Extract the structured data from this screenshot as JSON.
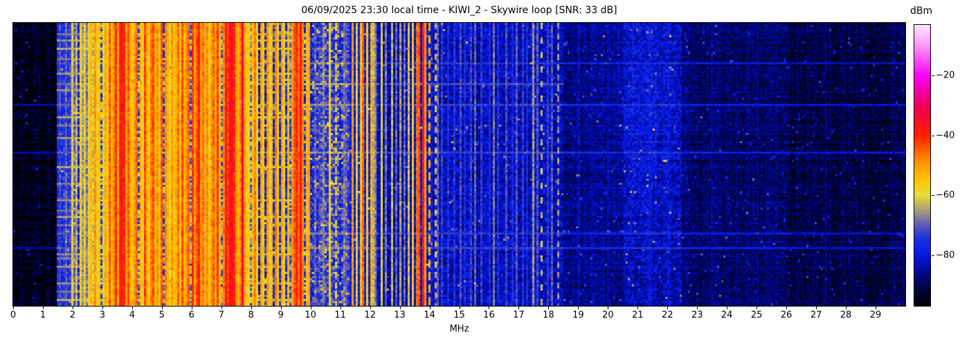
{
  "title": "06/09/2025 23:30 local time - KIWI_2 - Skywire loop [SNR: 33 dB]",
  "station": "KIWI_2",
  "antenna": "Skywire loop",
  "snr_db": 33,
  "timestamp_text": "06/09/2025 23:30 local time",
  "x_axis": {
    "label": "MHz",
    "range": [
      0,
      30
    ],
    "ticks": [
      0,
      1,
      2,
      3,
      4,
      5,
      6,
      7,
      8,
      9,
      10,
      11,
      12,
      13,
      14,
      15,
      16,
      17,
      18,
      19,
      20,
      21,
      22,
      23,
      24,
      25,
      26,
      27,
      28,
      29
    ]
  },
  "colorbar": {
    "label": "dBm",
    "min": -97,
    "max": -3,
    "ticks": [
      {
        "value": -20,
        "label": "−20"
      },
      {
        "value": -40,
        "label": "−40"
      },
      {
        "value": -60,
        "label": "−60"
      },
      {
        "value": -80,
        "label": "−80"
      }
    ],
    "stops": [
      [
        0.0,
        "#000000"
      ],
      [
        0.06,
        "#000340"
      ],
      [
        0.12,
        "#00088f"
      ],
      [
        0.181,
        "#0718e2"
      ],
      [
        0.24,
        "#1c30dc"
      ],
      [
        0.29,
        "#5f5cb4"
      ],
      [
        0.33,
        "#9c9088"
      ],
      [
        0.394,
        "#e8dc3a"
      ],
      [
        0.45,
        "#ffc400"
      ],
      [
        0.52,
        "#ff8a00"
      ],
      [
        0.606,
        "#ff2000"
      ],
      [
        0.7,
        "#ee0048"
      ],
      [
        0.819,
        "#fa00fa"
      ],
      [
        0.93,
        "#ff9af8"
      ],
      [
        1.0,
        "#ffe6ff"
      ]
    ]
  },
  "chart_data": {
    "type": "heatmap",
    "title": "06/09/2025 23:30 local time - KIWI_2 - Skywire loop [SNR: 33 dB]",
    "xlabel": "MHz",
    "x_range": [
      0,
      30
    ],
    "value_unit": "dBm",
    "value_range": [
      -97,
      -3
    ],
    "legend": "waterfall spectrogram, time on vertical axis, frequency 0-30 MHz on horizontal axis",
    "bands": [
      {
        "a": 0.0,
        "b": 1.45,
        "l": -94.5
      },
      {
        "a": 1.45,
        "b": 2.0,
        "l": -80
      },
      {
        "a": 2.0,
        "b": 2.6,
        "l": -78
      },
      {
        "a": 2.6,
        "b": 3.2,
        "l": -74
      },
      {
        "a": 3.2,
        "b": 8.0,
        "l": -71
      },
      {
        "a": 8.0,
        "b": 9.3,
        "l": -77
      },
      {
        "a": 9.3,
        "b": 10.0,
        "l": -73
      },
      {
        "a": 10.0,
        "b": 11.3,
        "l": -76
      },
      {
        "a": 11.3,
        "b": 12.3,
        "l": -80
      },
      {
        "a": 12.3,
        "b": 13.4,
        "l": -84
      },
      {
        "a": 13.4,
        "b": 14.1,
        "l": -80
      },
      {
        "a": 14.1,
        "b": 18.5,
        "l": -83
      },
      {
        "a": 18.5,
        "b": 20.5,
        "l": -86.5
      },
      {
        "a": 20.5,
        "b": 22.5,
        "l": -84
      },
      {
        "a": 22.5,
        "b": 26.0,
        "l": -88.5
      },
      {
        "a": 26.0,
        "b": 30.0,
        "l": -91
      }
    ],
    "clouds": [
      {
        "f": 21.3,
        "fw": 1.1,
        "y": 0.3,
        "yw": 0.4,
        "g": 5
      },
      {
        "f": 10.6,
        "fw": 0.9,
        "y": 0.5,
        "yw": 0.7,
        "g": 2
      }
    ],
    "signals": [
      {
        "f": 1.48,
        "l": -76
      },
      {
        "f": 1.55,
        "l": -72
      },
      {
        "f": 1.62,
        "l": -76
      },
      {
        "f": 1.7,
        "l": -74
      },
      {
        "f": 1.78,
        "l": -70
      },
      {
        "f": 1.85,
        "l": -75
      },
      {
        "f": 1.93,
        "l": -73
      },
      {
        "f": 2.02,
        "l": -60
      },
      {
        "f": 2.08,
        "l": -70
      },
      {
        "f": 2.15,
        "l": -64
      },
      {
        "f": 2.24,
        "l": -57
      },
      {
        "f": 2.32,
        "l": -66
      },
      {
        "f": 2.4,
        "l": -60
      },
      {
        "f": 2.47,
        "l": -68
      },
      {
        "f": 2.55,
        "l": -58
      },
      {
        "f": 2.62,
        "l": -54
      },
      {
        "f": 2.7,
        "l": -62
      },
      {
        "f": 2.78,
        "l": -50
      },
      {
        "f": 2.86,
        "l": -58
      },
      {
        "f": 2.93,
        "l": -55
      },
      {
        "f": 3.0,
        "l": -60
      },
      {
        "f": 3.08,
        "l": -52
      },
      {
        "f": 3.15,
        "l": -57
      },
      {
        "f": 3.21,
        "l": -44
      },
      {
        "f": 3.28,
        "l": -54
      },
      {
        "f": 3.35,
        "l": -48
      },
      {
        "f": 3.42,
        "l": -41
      },
      {
        "f": 3.5,
        "l": -52
      },
      {
        "f": 3.58,
        "l": -38,
        "w": 0.12
      },
      {
        "f": 3.65,
        "l": -46
      },
      {
        "f": 3.72,
        "l": -40
      },
      {
        "f": 3.8,
        "l": -50
      },
      {
        "f": 3.87,
        "l": -44
      },
      {
        "f": 3.94,
        "l": -53
      },
      {
        "f": 4.02,
        "l": -56
      },
      {
        "f": 4.1,
        "l": -50
      },
      {
        "f": 4.18,
        "l": -45
      },
      {
        "f": 4.26,
        "l": -54
      },
      {
        "f": 4.33,
        "l": -58
      },
      {
        "f": 4.4,
        "l": -42
      },
      {
        "f": 4.48,
        "l": -52
      },
      {
        "f": 4.56,
        "l": -56
      },
      {
        "f": 4.64,
        "l": -47
      },
      {
        "f": 4.72,
        "l": -43
      },
      {
        "f": 4.8,
        "l": -53
      },
      {
        "f": 4.88,
        "l": -49
      },
      {
        "f": 4.95,
        "l": -55
      },
      {
        "f": 5.02,
        "l": -44
      },
      {
        "f": 5.1,
        "l": -48
      },
      {
        "f": 5.18,
        "l": -54
      },
      {
        "f": 5.26,
        "l": -58
      },
      {
        "f": 5.33,
        "l": -50
      },
      {
        "f": 5.4,
        "l": -56
      },
      {
        "f": 5.48,
        "l": -52
      },
      {
        "f": 5.55,
        "l": -46
      },
      {
        "f": 5.62,
        "l": -55
      },
      {
        "f": 5.7,
        "l": -43
      },
      {
        "f": 5.78,
        "l": -53
      },
      {
        "f": 5.85,
        "l": -49
      },
      {
        "f": 5.93,
        "l": -45
      },
      {
        "f": 6.0,
        "l": -41
      },
      {
        "f": 6.07,
        "l": -50
      },
      {
        "f": 6.15,
        "l": -44
      },
      {
        "f": 6.22,
        "l": -39,
        "w": 0.1
      },
      {
        "f": 6.3,
        "l": -51
      },
      {
        "f": 6.37,
        "l": -46
      },
      {
        "f": 6.45,
        "l": -54
      },
      {
        "f": 6.52,
        "l": -48
      },
      {
        "f": 6.6,
        "l": -57
      },
      {
        "f": 6.68,
        "l": -50
      },
      {
        "f": 6.76,
        "l": -45
      },
      {
        "f": 6.83,
        "l": -52
      },
      {
        "f": 6.9,
        "l": -41
      },
      {
        "f": 6.97,
        "l": -54
      },
      {
        "f": 7.05,
        "l": -47
      },
      {
        "f": 7.12,
        "l": -38
      },
      {
        "f": 7.2,
        "l": -42
      },
      {
        "f": 7.28,
        "l": -36,
        "w": 0.12
      },
      {
        "f": 7.35,
        "l": -44
      },
      {
        "f": 7.42,
        "l": -40
      },
      {
        "f": 7.5,
        "l": -49
      },
      {
        "f": 7.58,
        "l": -53
      },
      {
        "f": 7.65,
        "l": -47
      },
      {
        "f": 7.72,
        "l": -31,
        "w": 0.1
      },
      {
        "f": 7.8,
        "l": -50
      },
      {
        "f": 7.88,
        "l": -56
      },
      {
        "f": 7.95,
        "l": -58
      },
      {
        "f": 8.03,
        "l": -54
      },
      {
        "f": 8.12,
        "l": -47
      },
      {
        "f": 8.22,
        "l": -58
      },
      {
        "f": 8.32,
        "l": -51
      },
      {
        "f": 8.42,
        "l": -56
      },
      {
        "f": 8.52,
        "l": -49
      },
      {
        "f": 8.62,
        "l": -60
      },
      {
        "f": 8.72,
        "l": -54
      },
      {
        "f": 8.82,
        "l": -47
      },
      {
        "f": 8.92,
        "l": -57
      },
      {
        "f": 9.02,
        "l": -51
      },
      {
        "f": 9.12,
        "l": -59
      },
      {
        "f": 9.22,
        "l": -54
      },
      {
        "f": 9.35,
        "l": -50
      },
      {
        "f": 9.45,
        "l": -44
      },
      {
        "f": 9.52,
        "l": -40,
        "w": 0.1
      },
      {
        "f": 9.6,
        "l": -46
      },
      {
        "f": 9.68,
        "l": -37,
        "w": 0.1
      },
      {
        "f": 9.76,
        "l": -49
      },
      {
        "f": 9.84,
        "l": -54
      },
      {
        "f": 9.92,
        "l": -51
      },
      {
        "f": 10.12,
        "l": -70
      },
      {
        "f": 10.3,
        "l": -72
      },
      {
        "f": 10.45,
        "l": -68
      },
      {
        "f": 10.65,
        "l": -58
      },
      {
        "f": 10.84,
        "l": -62,
        "d": 0.6,
        "p": 5
      },
      {
        "f": 11.1,
        "l": -68
      },
      {
        "f": 11.22,
        "l": -71
      },
      {
        "f": 11.42,
        "l": -50
      },
      {
        "f": 11.55,
        "l": -60
      },
      {
        "f": 11.7,
        "l": -55
      },
      {
        "f": 11.77,
        "l": -45
      },
      {
        "f": 11.9,
        "l": -58
      },
      {
        "f": 12.0,
        "l": -52
      },
      {
        "f": 12.1,
        "l": -63
      },
      {
        "f": 12.2,
        "l": -67
      },
      {
        "f": 12.4,
        "l": -60
      },
      {
        "f": 12.55,
        "l": -68
      },
      {
        "f": 12.7,
        "l": -63
      },
      {
        "f": 12.85,
        "l": -70
      },
      {
        "f": 13.0,
        "l": -65
      },
      {
        "f": 13.15,
        "l": -69
      },
      {
        "f": 13.31,
        "l": -62
      },
      {
        "f": 13.45,
        "l": -56
      },
      {
        "f": 13.57,
        "l": -46
      },
      {
        "f": 13.64,
        "l": -44
      },
      {
        "f": 13.75,
        "l": -38,
        "w": 0.1
      },
      {
        "f": 13.87,
        "l": -50
      },
      {
        "f": 14.0,
        "l": -52,
        "d": 0.6,
        "p": 6
      },
      {
        "f": 14.17,
        "l": -63,
        "d": 0.5,
        "p": 5
      },
      {
        "f": 14.28,
        "l": -70
      },
      {
        "f": 14.4,
        "l": -74
      },
      {
        "f": 14.6,
        "l": -76
      },
      {
        "f": 14.85,
        "l": -75
      },
      {
        "f": 15.0,
        "l": -72
      },
      {
        "f": 15.15,
        "l": -76
      },
      {
        "f": 15.35,
        "l": -73
      },
      {
        "f": 15.55,
        "l": -70
      },
      {
        "f": 15.75,
        "l": -74
      },
      {
        "f": 16.0,
        "l": -76
      },
      {
        "f": 16.12,
        "l": -68
      },
      {
        "f": 16.3,
        "l": -75
      },
      {
        "f": 16.55,
        "l": -72
      },
      {
        "f": 16.8,
        "l": -76
      },
      {
        "f": 16.95,
        "l": -71
      },
      {
        "f": 17.1,
        "l": -74
      },
      {
        "f": 17.3,
        "l": -76
      },
      {
        "f": 17.5,
        "l": -66
      },
      {
        "f": 17.6,
        "l": -71
      },
      {
        "f": 17.75,
        "l": -62,
        "d": 0.3,
        "p": 7
      },
      {
        "f": 17.95,
        "l": -74
      },
      {
        "f": 18.1,
        "l": -71
      },
      {
        "f": 18.3,
        "l": -67,
        "d": 0.5,
        "p": 5
      },
      {
        "f": 19.0,
        "l": -83
      },
      {
        "f": 20.0,
        "l": -84
      },
      {
        "f": 21.4,
        "l": -80
      },
      {
        "f": 22.0,
        "l": -82
      },
      {
        "f": 23.5,
        "l": -86
      },
      {
        "f": 25.0,
        "l": -87
      },
      {
        "f": 27.3,
        "l": -88
      }
    ],
    "streaks": [
      {
        "y": 0.035,
        "a": 1.45,
        "b": 9.9,
        "g": 12
      },
      {
        "y": 0.055,
        "a": 1.45,
        "b": 9.9,
        "g": 14
      },
      {
        "y": 0.09,
        "a": 1.45,
        "b": 9.9,
        "g": 16
      },
      {
        "y": 0.125,
        "a": 1.45,
        "b": 6.0,
        "g": 12
      },
      {
        "y": 0.14,
        "a": 1.45,
        "b": 30,
        "g": 9
      },
      {
        "y": 0.175,
        "a": 1.45,
        "b": 9.9,
        "g": 14
      },
      {
        "y": 0.215,
        "a": 1.45,
        "b": 18.5,
        "g": 11
      },
      {
        "y": 0.23,
        "a": 1.45,
        "b": 8.0,
        "g": 13
      },
      {
        "y": 0.285,
        "a": 0.0,
        "b": 30,
        "g": 10
      },
      {
        "y": 0.33,
        "a": 1.45,
        "b": 9.9,
        "g": 15
      },
      {
        "y": 0.36,
        "a": 1.45,
        "b": 6.0,
        "g": 12
      },
      {
        "y": 0.4,
        "a": 1.45,
        "b": 9.0,
        "g": 14
      },
      {
        "y": 0.425,
        "a": 2.0,
        "b": 8.0,
        "g": 11
      },
      {
        "y": 0.455,
        "a": 0.0,
        "b": 30,
        "g": 10
      },
      {
        "y": 0.5,
        "a": 1.45,
        "b": 9.9,
        "g": 16
      },
      {
        "y": 0.53,
        "a": 2.5,
        "b": 8.0,
        "g": 12
      },
      {
        "y": 0.565,
        "a": 1.45,
        "b": 8.0,
        "g": 13
      },
      {
        "y": 0.62,
        "a": 1.45,
        "b": 9.9,
        "g": 13
      },
      {
        "y": 0.655,
        "a": 1.45,
        "b": 5.0,
        "g": 11
      },
      {
        "y": 0.68,
        "a": 1.45,
        "b": 9.9,
        "g": 15
      },
      {
        "y": 0.705,
        "a": 1.45,
        "b": 7.0,
        "g": 11
      },
      {
        "y": 0.735,
        "a": 1.45,
        "b": 30,
        "g": 9
      },
      {
        "y": 0.787,
        "a": 0.0,
        "b": 30,
        "g": 10
      },
      {
        "y": 0.81,
        "a": 1.45,
        "b": 9.9,
        "g": 14
      },
      {
        "y": 0.825,
        "a": 1.45,
        "b": 7.5,
        "g": 12
      },
      {
        "y": 0.855,
        "a": 1.45,
        "b": 9.0,
        "g": 14
      },
      {
        "y": 0.895,
        "a": 2.0,
        "b": 8.0,
        "g": 11
      },
      {
        "y": 0.91,
        "a": 1.45,
        "b": 9.9,
        "g": 13
      },
      {
        "y": 0.945,
        "a": 1.45,
        "b": 8.0,
        "g": 12
      },
      {
        "y": 0.97,
        "a": 1.45,
        "b": 9.9,
        "g": 15
      }
    ]
  }
}
